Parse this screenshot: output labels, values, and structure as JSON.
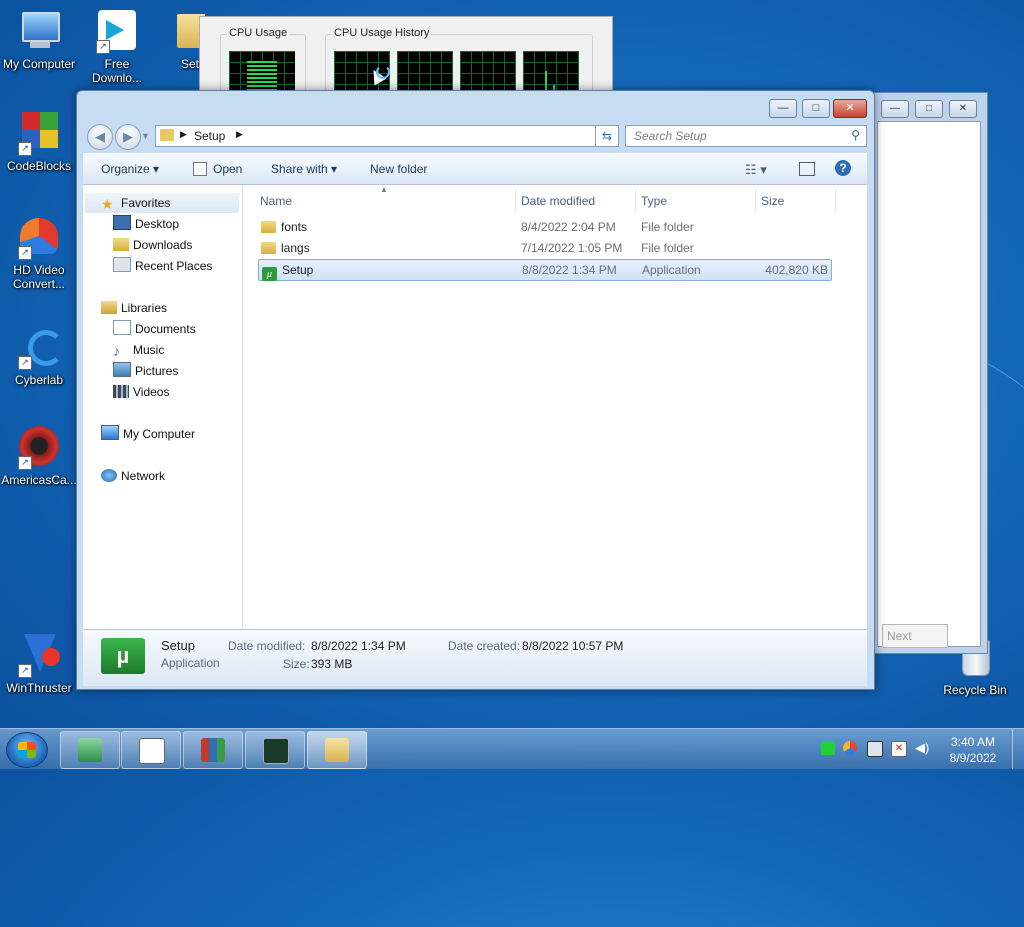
{
  "desktop": {
    "icons": [
      {
        "label": "My Computer"
      },
      {
        "label": "Free Downlo..."
      },
      {
        "label": "Setup"
      },
      {
        "label": "CodeBlocks"
      },
      {
        "label": "HD Video Convert..."
      },
      {
        "label": "Cyberlab"
      },
      {
        "label": "AmericasCa..."
      },
      {
        "label": "WinThruster"
      },
      {
        "label": "Recycle Bin"
      }
    ]
  },
  "taskmgr": {
    "cpu_usage_label": "CPU Usage",
    "cpu_history_label": "CPU Usage History"
  },
  "bg_dialog": {
    "next_label": "Next"
  },
  "explorer": {
    "caption": {
      "minimize": "—",
      "maximize": "□",
      "close": "✕"
    },
    "address": {
      "path": "Setup",
      "arrow": "▶"
    },
    "search": {
      "placeholder": "Search Setup"
    },
    "toolbar": {
      "organize": "Organize ▾",
      "open": "Open",
      "share": "Share with ▾",
      "new_folder": "New folder",
      "help": "?"
    },
    "nav": {
      "favorites": "Favorites",
      "desktop": "Desktop",
      "downloads": "Downloads",
      "recent": "Recent Places",
      "libraries": "Libraries",
      "documents": "Documents",
      "music": "Music",
      "pictures": "Pictures",
      "videos": "Videos",
      "computer": "My Computer",
      "network": "Network"
    },
    "columns": {
      "name": "Name",
      "date": "Date modified",
      "type": "Type",
      "size": "Size"
    },
    "files": [
      {
        "name": "fonts",
        "date": "8/4/2022 2:04 PM",
        "type": "File folder",
        "size": ""
      },
      {
        "name": "langs",
        "date": "7/14/2022 1:05 PM",
        "type": "File folder",
        "size": ""
      },
      {
        "name": "Setup",
        "date": "8/8/2022 1:34 PM",
        "type": "Application",
        "size": "402,820 KB"
      }
    ],
    "details": {
      "name": "Setup",
      "kind": "Application",
      "date_modified_label": "Date modified:",
      "date_modified": "8/8/2022 1:34 PM",
      "size_label": "Size:",
      "size": "393 MB",
      "date_created_label": "Date created:",
      "date_created": "8/8/2022 10:57 PM"
    }
  },
  "taskbar": {
    "time": "3:40 AM",
    "date": "8/9/2022"
  }
}
